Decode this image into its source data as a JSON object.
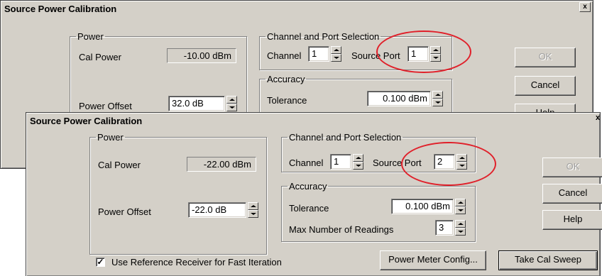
{
  "dialog1": {
    "title": "Source Power Calibration",
    "close": "x",
    "power_group": "Power",
    "cal_power_label": "Cal Power",
    "cal_power_value": "-10.00 dBm",
    "power_offset_label": "Power Offset",
    "power_offset_value": "32.0 dB",
    "channel_group": "Channel and Port Selection",
    "channel_label": "Channel",
    "channel_value": "1",
    "source_port_label": "Source Port",
    "source_port_value": "1",
    "accuracy_group": "Accuracy",
    "tolerance_label": "Tolerance",
    "tolerance_value": "0.100 dBm",
    "ok": "OK",
    "cancel": "Cancel",
    "help": "Help"
  },
  "dialog2": {
    "title": "Source Power Calibration",
    "close": "x",
    "power_group": "Power",
    "cal_power_label": "Cal Power",
    "cal_power_value": "-22.00 dBm",
    "power_offset_label": "Power Offset",
    "power_offset_value": "-22.0 dB",
    "channel_group": "Channel and Port Selection",
    "channel_label": "Channel",
    "channel_value": "1",
    "source_port_label": "Source Port",
    "source_port_value": "2",
    "accuracy_group": "Accuracy",
    "tolerance_label": "Tolerance",
    "tolerance_value": "0.100 dBm",
    "max_readings_label": "Max Number of Readings",
    "max_readings_value": "3",
    "ok": "OK",
    "cancel": "Cancel",
    "help": "Help",
    "use_ref_receiver_label": "Use Reference Receiver for Fast Iteration",
    "use_ref_receiver_checked": true,
    "check_mark": "✓",
    "power_meter_config": "Power Meter Config...",
    "take_cal_sweep": "Take Cal Sweep"
  },
  "colors": {
    "dialog_bg": "#d4d0c8",
    "highlight_ellipse": "#e0202a"
  }
}
